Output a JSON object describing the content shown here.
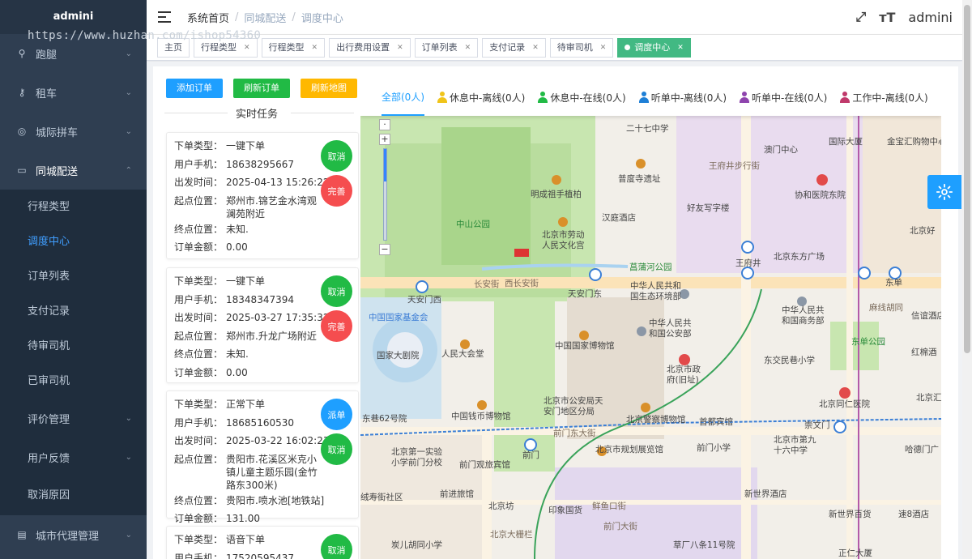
{
  "brand": "admini",
  "watermark": "https://www.huzhan.com/ishop54360",
  "sidebar": {
    "top_items": [
      {
        "label": "跑腿",
        "icon": "bike-icon"
      },
      {
        "label": "租车",
        "icon": "key-icon"
      },
      {
        "label": "城际拼车",
        "icon": "location-icon"
      },
      {
        "label": "同城配送",
        "icon": "truck-icon"
      }
    ],
    "sub_items": [
      "行程类型",
      "调度中心",
      "订单列表",
      "支付记录",
      "待审司机",
      "已审司机"
    ],
    "bottom_items": [
      "评价管理",
      "用户反馈",
      "取消原因"
    ],
    "last_item": {
      "label": "城市代理管理",
      "icon": "doc-icon"
    }
  },
  "header": {
    "breadcrumb": [
      "系统首页",
      "同城配送",
      "调度中心"
    ],
    "user": "admini"
  },
  "tags": [
    {
      "label": "主页",
      "closable": false
    },
    {
      "label": "行程类型",
      "closable": true
    },
    {
      "label": "行程类型",
      "closable": true
    },
    {
      "label": "出行费用设置",
      "closable": true
    },
    {
      "label": "订单列表",
      "closable": true
    },
    {
      "label": "支付记录",
      "closable": true
    },
    {
      "label": "待审司机",
      "closable": true
    },
    {
      "label": "调度中心",
      "closable": true,
      "active": true
    }
  ],
  "actions": {
    "add": "添加订单",
    "refresh_orders": "刷新订单",
    "refresh_map": "刷新地图"
  },
  "realtime_title": "实时任务",
  "field_labels": {
    "type": "下单类型：",
    "phone": "用户手机：",
    "time": "出发时间：",
    "start": "起点位置：",
    "end": "终点位置：",
    "amount": "订单金额："
  },
  "tasks": [
    {
      "type": "一键下单",
      "phone": "18638295667",
      "time": "2025-04-13 15:26:22",
      "start": "郑州市.锦艺金水湾观澜苑附近",
      "end": "未知.",
      "amount": "0.00",
      "buttons": [
        {
          "label": "取消",
          "color": "green"
        },
        {
          "label": "完善",
          "color": "red"
        }
      ]
    },
    {
      "type": "一键下单",
      "phone": "18348347394",
      "time": "2025-03-27 17:35:32",
      "start": "郑州市.升龙广场附近",
      "end": "未知.",
      "amount": "0.00",
      "buttons": [
        {
          "label": "取消",
          "color": "green"
        },
        {
          "label": "完善",
          "color": "red"
        }
      ]
    },
    {
      "type": "正常下单",
      "phone": "18685160530",
      "time": "2025-03-22 16:02:23",
      "start": "贵阳市.花溪区米克小镇儿童主题乐园(金竹路东300米)",
      "end": "贵阳市.喷水池[地铁站]",
      "amount": "131.00",
      "buttons": [
        {
          "label": "派单",
          "color": "blue"
        },
        {
          "label": "取消",
          "color": "green"
        }
      ]
    },
    {
      "type": "语音下单",
      "phone": "17520595437",
      "buttons": [
        {
          "label": "取消",
          "color": "green"
        }
      ]
    }
  ],
  "driver_status": [
    {
      "label": "全部(0人)",
      "color": "#1e9fff",
      "active": true
    },
    {
      "label": "休息中-离线(0人)",
      "color": "#f0c419"
    },
    {
      "label": "休息中-在线(0人)",
      "color": "#21ba45"
    },
    {
      "label": "听单中-离线(0人)",
      "color": "#1e7fd6"
    },
    {
      "label": "听单中-在线(0人)",
      "color": "#8e44ad"
    },
    {
      "label": "工作中-离线(0人)",
      "color": "#c0396b"
    }
  ],
  "map_labels": [
    "二十七中学",
    "澳门中心",
    "国际大厦",
    "金宝汇购物中心",
    "王府井步行街",
    "普度寺遗址",
    "明成祖手植柏",
    "协和医院东院",
    "汉庭酒店",
    "好友写字楼",
    "中山公园",
    "北京市劳动人民文化宫",
    "菖蒲河公园",
    "王府井",
    "北京东方广场",
    "北京好",
    "长安街",
    "西长安街",
    "天安门西",
    "天安门东",
    "中华人民共和国生态环境部",
    "东单",
    "麻线胡同",
    "中华人民共和国商务部",
    "信谊酒店",
    "中国国家基金会",
    "中华人民共和国公安部",
    "东单公园",
    "国家大剧院",
    "人民大会堂",
    "中国国家博物馆",
    "东交民巷小学",
    "红棉酒",
    "北京市政府(旧址)",
    "北京同仁医院",
    "北京汇",
    "北京市公安局天安门地区分局",
    "北京警察博物馆",
    "首都宾馆",
    "中国钱币博物馆",
    "崇文门",
    "东巷62号院",
    "前门东大街",
    "北京市规划展览馆",
    "前门小学",
    "北京市第九十六中学",
    "哈德门广",
    "北京第一实验小学前门分校",
    "前门",
    "前门观旅宾馆",
    "新世界酒店",
    "绒寿街社区",
    "前进旅馆",
    "北京坊",
    "鲜鱼口街",
    "新世界百货",
    "速8酒店",
    "北京大栅栏",
    "印象国货",
    "前门大街",
    "炭儿胡同小学",
    "草厂八条11号院",
    "正仁大厦"
  ]
}
